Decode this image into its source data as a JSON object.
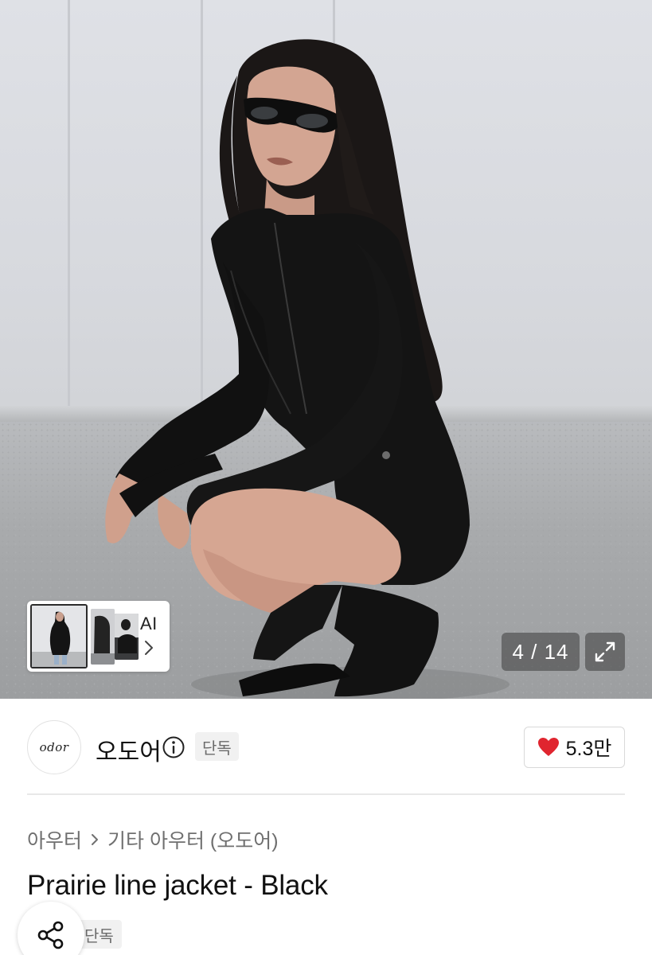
{
  "gallery": {
    "counter": "4 / 14",
    "ai_label": "AI",
    "icons": {
      "expand": "expand-icon",
      "next": "chevron-right-icon"
    }
  },
  "seller": {
    "logo_text": "odor",
    "name": "오도어",
    "badge": "단독",
    "likes": "5.3만",
    "icons": {
      "info": "info-icon",
      "like": "heart-icon"
    },
    "like_color": "#e0252f"
  },
  "product": {
    "breadcrumb": [
      "아우터",
      "기타 아우터 (오도어)"
    ],
    "title": "Prairie line jacket - Black",
    "badge": "단독",
    "icons": {
      "share": "share-icon",
      "separator": "chevron-right-icon"
    }
  }
}
